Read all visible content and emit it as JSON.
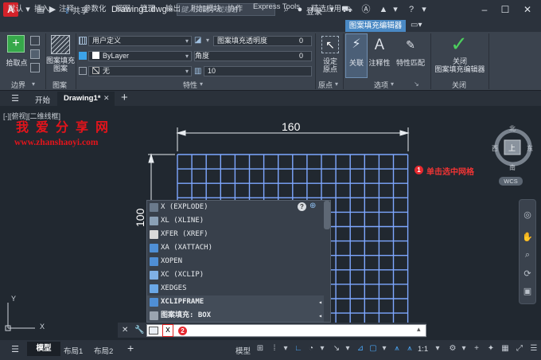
{
  "titlebar": {
    "logo": "A",
    "share": "共享",
    "title": "Drawing1.dwg",
    "search_placeholder": "键入关键字或短语",
    "login": "登录"
  },
  "ribbon_tabs": [
    {
      "label": "默认"
    },
    {
      "label": "插入"
    },
    {
      "label": "注释"
    },
    {
      "label": "参数化"
    },
    {
      "label": "视图"
    },
    {
      "label": "管理"
    },
    {
      "label": "输出"
    },
    {
      "label": "附加模块"
    },
    {
      "label": "协作"
    },
    {
      "label": "Express Tools"
    },
    {
      "label": "精选应用"
    }
  ],
  "active_tab": "图案填充编辑器",
  "ribbon": {
    "pick_points": "拾取点",
    "hatch_pattern_label": "图案填充\n图案",
    "pattern_type": "用户定义",
    "transparency_label": "图案填充透明度",
    "transparency_value": "0",
    "color": "ByLayer",
    "angle_label": "角度",
    "angle_value": "0",
    "bg_color": "无",
    "spacing_value": "10",
    "set_origin": "设定\n原点",
    "associative": "关联",
    "annotative": "注释性",
    "match_props": "特性匹配",
    "close": "关闭\n图案填充编辑器",
    "groups": {
      "boundary": "边界",
      "pattern": "图案",
      "properties": "特性",
      "origin": "原点",
      "options": "选项",
      "close": "关闭"
    }
  },
  "doc_tabs": {
    "start": "开始",
    "drawing": "Drawing1*"
  },
  "viewport": {
    "label": "[-][俯视][二维线框]",
    "watermark_cn": "我爱分享网",
    "watermark_url": "www.zhanshaoyi.com",
    "dim_width": "160",
    "dim_height": "100",
    "note_badge": "1",
    "note": "单击选中网格",
    "ucs_x": "X",
    "ucs_y": "Y"
  },
  "viewcube": {
    "north": "北",
    "south": "南",
    "east": "东",
    "west": "西",
    "top": "上",
    "wcs": "WCS"
  },
  "autocomplete": {
    "items": [
      {
        "label": "X (EXPLODE)",
        "color": "#6a7a8c",
        "bold": false
      },
      {
        "label": "XL (XLINE)",
        "color": "#8aa0b6",
        "bold": false
      },
      {
        "label": "XFER (XREF)",
        "color": "#d9d9d9",
        "bold": false
      },
      {
        "label": "XA (XATTACH)",
        "color": "#4f8fd6",
        "bold": false
      },
      {
        "label": "XOPEN",
        "color": "#4f8fd6",
        "bold": false
      },
      {
        "label": "XC (XCLIP)",
        "color": "#7fb0e6",
        "bold": false
      },
      {
        "label": "XEDGES",
        "color": "#6aa7e6",
        "bold": false
      },
      {
        "label": "XCLIPFRAME",
        "color": "#4f8fd6",
        "bold": true
      },
      {
        "label": "图案填充: BOX",
        "color": "#9aa4b0",
        "bold": true
      }
    ]
  },
  "cmdline": {
    "text": "x",
    "badge": "2"
  },
  "statusbar": {
    "tabs": [
      {
        "label": "模型"
      },
      {
        "label": "布局1"
      },
      {
        "label": "布局2"
      }
    ],
    "model": "模型",
    "scale": "1:1"
  },
  "colors": {
    "accent": "#4a89c4",
    "grid": "#7ea7ff",
    "note": "#ef3434",
    "watermark": "#e3141b"
  }
}
